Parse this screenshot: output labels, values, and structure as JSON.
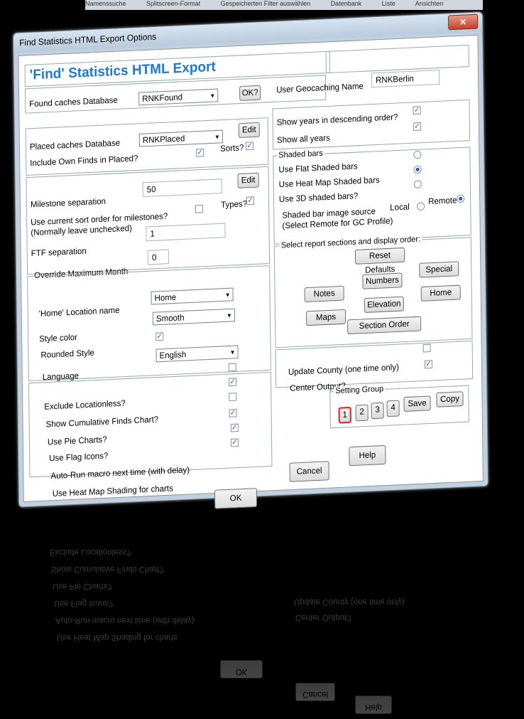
{
  "background_strip": [
    "Namenssuche",
    "Splitscreen-Format",
    "Gespeicherten Filter auswählen",
    "Datenbank",
    "Liste",
    "Ansichten"
  ],
  "window": {
    "title": "Find Statistics HTML Export Options",
    "close_glyph": "✕"
  },
  "header": {
    "title": "'Find' Statistics HTML Export"
  },
  "found": {
    "label": "Found caches Database",
    "value": "RNKFound",
    "ok_button": "OK?"
  },
  "user": {
    "label": "User Geocaching Name",
    "value": "RNKBerlin"
  },
  "placed": {
    "label": "Placed caches Database",
    "value": "RNKPlaced",
    "edit_button": "Edit",
    "include_label": "Include Own Finds in Placed?",
    "sorts_label": "Sorts?"
  },
  "years": {
    "descending_label": "Show years in descending order?",
    "all_label": "Show all years"
  },
  "milestone": {
    "label": "Milestone separation",
    "value": "50",
    "edit_button": "Edit",
    "sort_label_1": "Use current sort order for milestones?",
    "sort_label_2": "(Normally leave unchecked)",
    "types_label": "Types?"
  },
  "ftf": {
    "label": "FTF separation",
    "value": "1"
  },
  "maxmonth": {
    "label": "Override Maximum Month",
    "value": "0"
  },
  "shaded": {
    "legend": "Shaded bars",
    "flat": "Use Flat Shaded bars",
    "heat": "Use Heat Map Shaded bars",
    "three_d": "Use 3D shaded bars?",
    "source_1": "Shaded bar image source",
    "source_2": "(Select Remote for GC Profile)",
    "local": "Local",
    "remote": "Remote"
  },
  "home": {
    "label": "'Home' Location name",
    "value": "Home"
  },
  "style": {
    "label": "Style color",
    "value": "Smooth"
  },
  "rounded": {
    "label": "Rounded Style"
  },
  "language": {
    "label": "Language",
    "value": "English"
  },
  "sections": {
    "legend": "Select report sections and display order:",
    "reset": "Reset Defaults",
    "notes": "Notes",
    "numbers": "Numbers",
    "special": "Special",
    "maps": "Maps",
    "elevation": "Elevation",
    "home": "Home",
    "section_order": "Section Order"
  },
  "options": {
    "exclude": "Exclude Locationless?",
    "cumulative": "Show Cumulative Finds Chart?",
    "pie": "Use Pie Charts?",
    "flag": "Use Flag Icons?",
    "autorun": "Auto-Run macro next time (with delay)",
    "heatmap": "Use Heat Map Shading for charts"
  },
  "county": {
    "label": "Update County (one time only)"
  },
  "center": {
    "label": "Center Output?"
  },
  "setting": {
    "legend": "Setting Group",
    "g1": "1",
    "g2": "2",
    "g3": "3",
    "g4": "4",
    "save": "Save",
    "copy": "Copy"
  },
  "footer": {
    "ok": "OK",
    "cancel": "Cancel",
    "help": "Help"
  },
  "check_glyph": "✓"
}
